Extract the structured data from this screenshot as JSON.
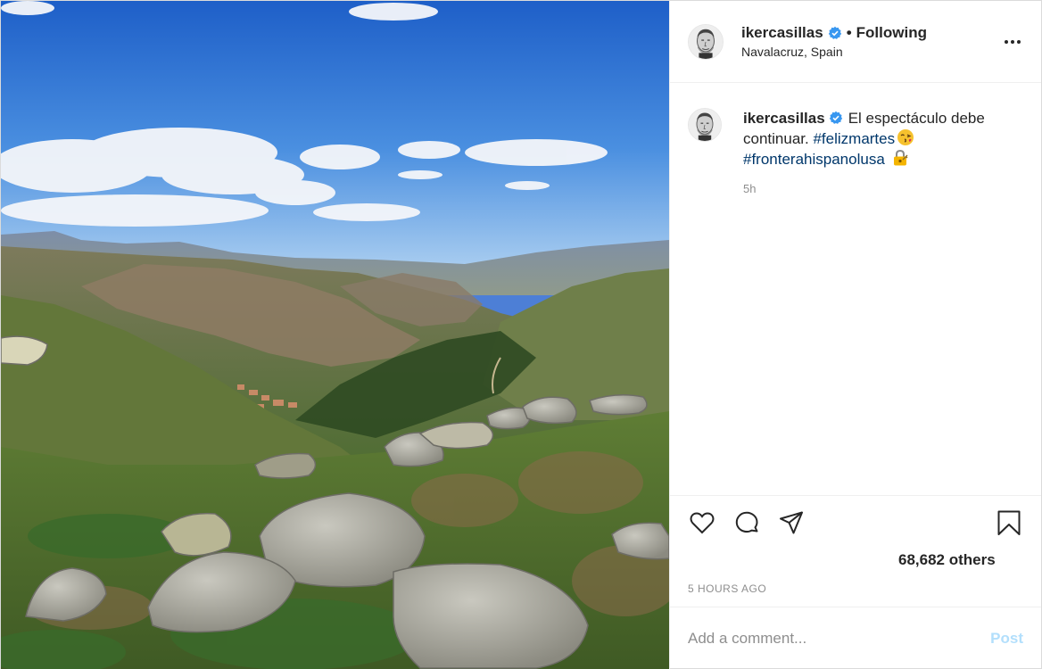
{
  "post": {
    "author": {
      "username": "ikercasillas",
      "verified": true,
      "follow_state": "Following",
      "separator": "•",
      "location": "Navalacruz, Spain"
    },
    "caption": {
      "username": "ikercasillas",
      "text": "El espectáculo debe continuar.",
      "hashtags": [
        "#felizmartes",
        "#fronterahispanolusa"
      ],
      "emojis": [
        "kissing-face-emoji",
        "locked-with-key-emoji"
      ],
      "timestamp": "5h"
    },
    "actions": {
      "icons": [
        "heart-icon",
        "comment-icon",
        "share-icon",
        "bookmark-icon"
      ]
    },
    "likes_text": "68,682 others",
    "time_ago": "5 HOURS AGO",
    "comment_box": {
      "placeholder": "Add a comment...",
      "post_label": "Post"
    },
    "more_label": "•••",
    "colors": {
      "link_blue": "#00376b",
      "verified_blue": "#3897f0",
      "post_disabled": "#b2dffc",
      "secondary_text": "#8e8e8e"
    }
  }
}
